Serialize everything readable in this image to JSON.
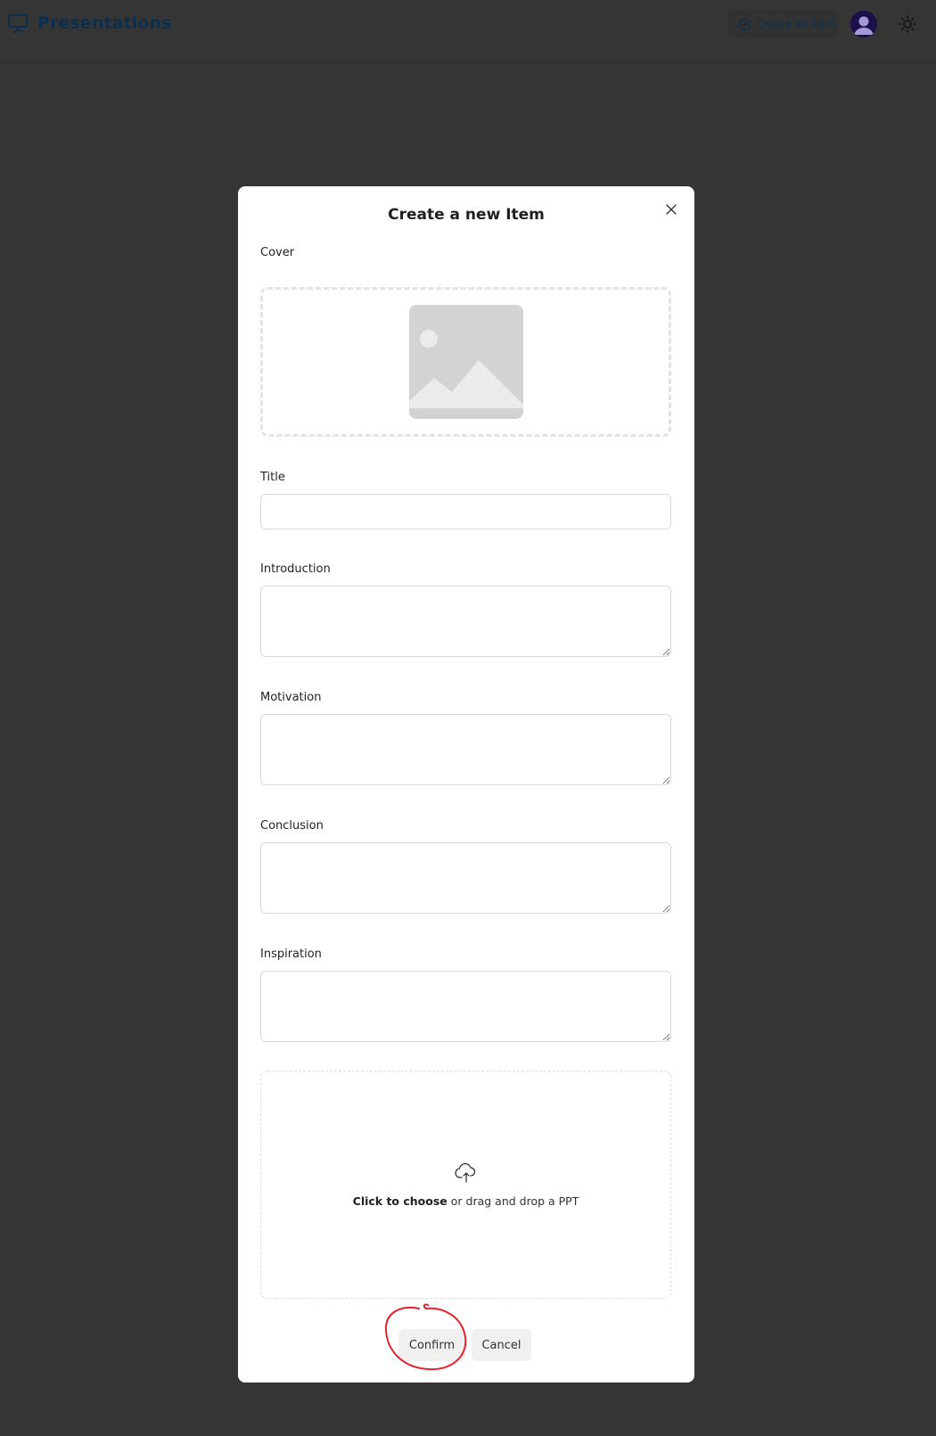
{
  "header": {
    "title": "Presentations",
    "create_label": "Create an item",
    "brand_color": "#0b2f4d"
  },
  "modal": {
    "title": "Create a new Item",
    "labels": {
      "cover": "Cover",
      "title": "Title",
      "introduction": "Introduction",
      "motivation": "Motivation",
      "conclusion": "Conclusion",
      "inspiration": "Inspiration"
    },
    "fields": {
      "title": {
        "value": "",
        "placeholder": ""
      },
      "introduction": {
        "value": "",
        "placeholder": ""
      },
      "motivation": {
        "value": "",
        "placeholder": ""
      },
      "conclusion": {
        "value": "",
        "placeholder": ""
      },
      "inspiration": {
        "value": "",
        "placeholder": ""
      }
    },
    "upload": {
      "bold": "Click to choose",
      "rest": " or drag and drop a PPT"
    },
    "buttons": {
      "confirm": "Confirm",
      "cancel": "Cancel"
    }
  },
  "icons": {
    "brand": "presentation-board-icon",
    "create": "plus-circle-icon",
    "avatar": "user-avatar-icon",
    "theme": "sun-icon",
    "close": "close-icon",
    "cover": "image-placeholder-icon",
    "upload": "cloud-upload-icon"
  },
  "annotation_color": "#e8202a"
}
